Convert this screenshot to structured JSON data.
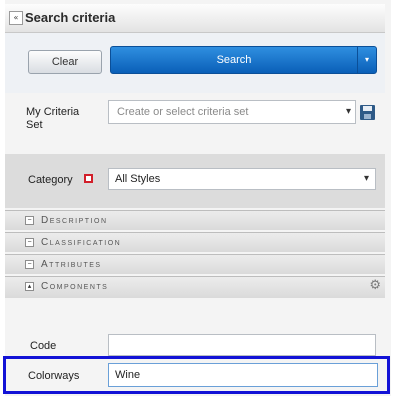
{
  "header": {
    "collapse_glyph": "«",
    "title": "Search criteria"
  },
  "actions": {
    "clear_label": "Clear",
    "search_label": "Search",
    "search_menu_glyph": "▾"
  },
  "criteria_set": {
    "label": "My Criteria Set",
    "placeholder": "Create or select criteria set",
    "arrow": "▾",
    "save_icon": "save-icon"
  },
  "category": {
    "label": "Category",
    "required": true,
    "value": "All Styles",
    "arrow": "▾"
  },
  "sections": [
    {
      "label": "Description",
      "toggle": "−",
      "expanded": false
    },
    {
      "label": "Classification",
      "toggle": "−",
      "expanded": false
    },
    {
      "label": "Attributes",
      "toggle": "−",
      "expanded": false
    },
    {
      "label": "Components",
      "toggle": "▴",
      "expanded": true,
      "gear": "⚙"
    }
  ],
  "components": {
    "code_label": "Code",
    "code_value": "",
    "colorways_label": "Colorways",
    "colorways_value": "Wine"
  },
  "colors": {
    "search_button": "#0a5fb8",
    "highlight": "#1212d6",
    "required": "#d21f2a"
  }
}
